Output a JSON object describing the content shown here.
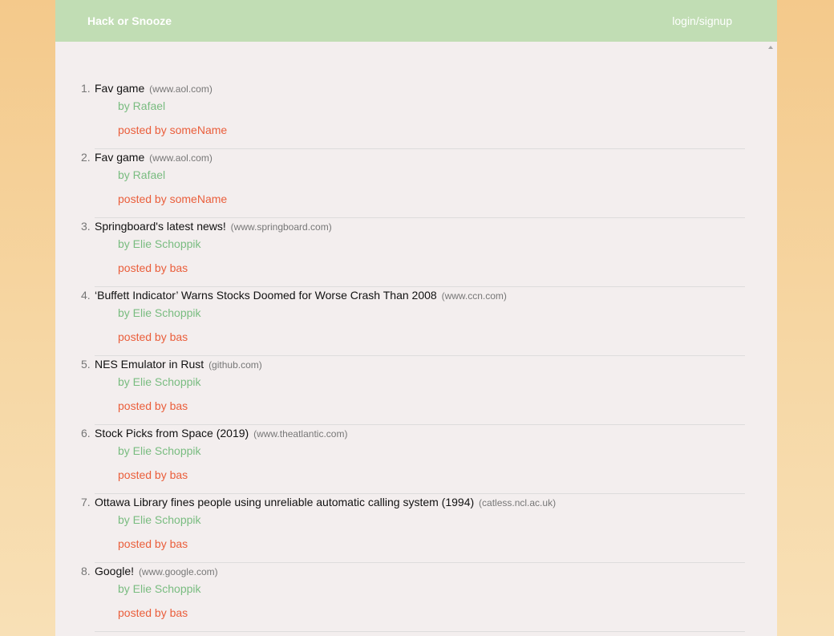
{
  "nav": {
    "brand": "Hack or Snooze",
    "login": "login/signup"
  },
  "stories": [
    {
      "num": "1.",
      "title": "Fav game",
      "host": "(www.aol.com)",
      "author": "by Rafael",
      "poster": "posted by someName"
    },
    {
      "num": "2.",
      "title": "Fav game",
      "host": "(www.aol.com)",
      "author": "by Rafael",
      "poster": "posted by someName"
    },
    {
      "num": "3.",
      "title": "Springboard's latest news!",
      "host": "(www.springboard.com)",
      "author": "by Elie Schoppik",
      "poster": "posted by bas"
    },
    {
      "num": "4.",
      "title": "‘Buffett Indicator’ Warns Stocks Doomed for Worse Crash Than 2008",
      "host": "(www.ccn.com)",
      "author": "by Elie Schoppik",
      "poster": "posted by bas"
    },
    {
      "num": "5.",
      "title": "NES Emulator in Rust",
      "host": "(github.com)",
      "author": "by Elie Schoppik",
      "poster": "posted by bas"
    },
    {
      "num": "6.",
      "title": "Stock Picks from Space (2019)",
      "host": "(www.theatlantic.com)",
      "author": "by Elie Schoppik",
      "poster": "posted by bas"
    },
    {
      "num": "7.",
      "title": "Ottawa Library fines people using unreliable automatic calling system (1994)",
      "host": "(catless.ncl.ac.uk)",
      "author": "by Elie Schoppik",
      "poster": "posted by bas"
    },
    {
      "num": "8.",
      "title": "Google!",
      "host": "(www.google.com)",
      "author": "by Elie Schoppik",
      "poster": "posted by bas"
    }
  ]
}
